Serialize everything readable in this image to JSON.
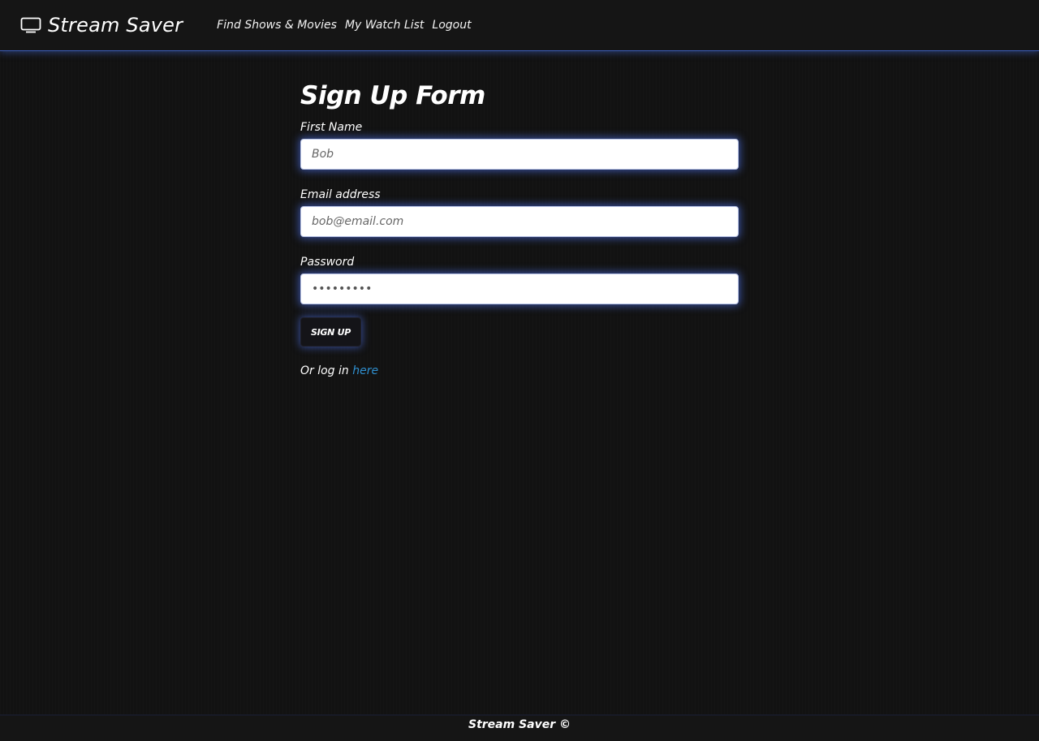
{
  "navbar": {
    "brand": "Stream Saver",
    "brand_icon": "tv-icon",
    "links": [
      {
        "label": "Find Shows & Movies"
      },
      {
        "label": "My Watch List"
      },
      {
        "label": "Logout"
      }
    ]
  },
  "form": {
    "title": "Sign Up Form",
    "first_name": {
      "label": "First Name",
      "placeholder": "Bob"
    },
    "email": {
      "label": "Email address",
      "placeholder": "bob@email.com"
    },
    "password": {
      "label": "Password",
      "value": "•••••••••"
    },
    "submit_label": "SIGN UP",
    "login_prefix": "Or log in",
    "login_link": "here"
  },
  "footer": {
    "text": "Stream Saver ©"
  },
  "colors": {
    "background": "#121212",
    "accent_glow": "#4a6cdc",
    "link": "#2f8fcf"
  }
}
